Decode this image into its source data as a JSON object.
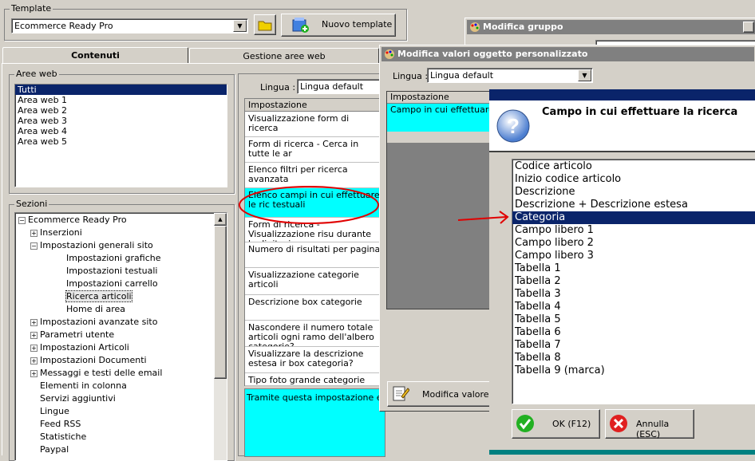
{
  "template": {
    "legend": "Template",
    "selected": "Ecommerce Ready Pro",
    "new_button": "Nuovo template"
  },
  "tabs": [
    "Contenuti",
    "Gestione aree web"
  ],
  "aree_web": {
    "legend": "Aree web",
    "items": [
      "Tutti",
      "Area web 1",
      "Area web 2",
      "Area web 3",
      "Area web 4",
      "Area web 5"
    ]
  },
  "sezioni": {
    "legend": "Sezioni",
    "root": "Ecommerce Ready Pro",
    "items": [
      "Inserzioni",
      "Impostazioni generali sito",
      "Impostazioni grafiche",
      "Impostazioni testuali",
      "Impostazioni carrello",
      "Ricerca articoli",
      "Home di area",
      "Impostazioni avanzate sito",
      "Parametri utente",
      "Impostazioni Articoli",
      "Impostazioni Documenti",
      "Messaggi e testi delle email",
      "Elementi in colonna",
      "Servizi aggiuntivi",
      "Lingue",
      "Feed RSS",
      "Statistiche",
      "Paypal"
    ]
  },
  "settings": {
    "lingua_label": "Lingua :",
    "lingua_value": "Lingua default",
    "header": "Impostazione",
    "rows": [
      "Visualizzazione form di ricerca",
      "Form di ricerca - Cerca in tutte le ar",
      "Elenco filtri per ricerca avanzata",
      "Elenco campi in cui effettuare le ric testuali",
      "Form di ricerca - Visualizzazione risu durante la digitazione",
      "Numero di risultati per pagina",
      "Visualizzazione categorie articoli",
      "Descrizione box categorie",
      "Nascondere il numero totale articoli ogni ramo dell'albero categorie?",
      "Visualizzare la descrizione estesa ir box categoria?",
      "Tipo foto grande categorie"
    ],
    "description": "Tramite questa impostazione e' pos"
  },
  "modifica_gruppo": {
    "title": "Modifica gruppo"
  },
  "modifica_valori": {
    "title": "Modifica valori oggetto personalizzato",
    "lingua_label": "Lingua :",
    "lingua_value": "Lingua default",
    "header": "Impostazione",
    "row": "Campo in cui effettuare la",
    "edit_button": "Modifica valore"
  },
  "dialog": {
    "question": "Campo in cui effettuare la ricerca",
    "options": [
      "Codice articolo",
      "Inizio codice articolo",
      "Descrizione",
      "Descrizione + Descrizione estesa",
      "Categoria",
      "Campo libero 1",
      "Campo libero 2",
      "Campo libero 3",
      "Tabella 1",
      "Tabella 2",
      "Tabella 3",
      "Tabella 4",
      "Tabella 5",
      "Tabella 6",
      "Tabella 7",
      "Tabella 8",
      "Tabella 9 (marca)"
    ],
    "selected_index": 4,
    "ok": "OK (F12)",
    "cancel": "Annulla (ESC)"
  },
  "colors": {
    "selection": "#0a246a",
    "cyan": "#00ffff",
    "annotation_red": "#e00000"
  }
}
